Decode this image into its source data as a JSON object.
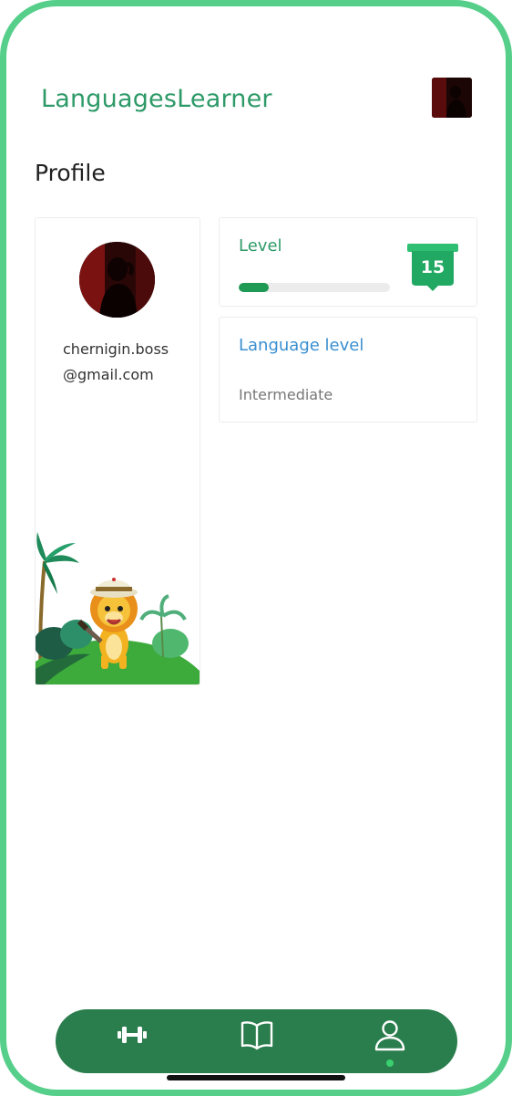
{
  "header": {
    "app_title": "LanguagesLearner"
  },
  "page": {
    "title": "Profile"
  },
  "profile": {
    "email_line1": "chernigin.boss",
    "email_line2": "@gmail.com"
  },
  "level_card": {
    "title": "Level",
    "level": "15",
    "progress_fraction": 0.2
  },
  "language_card": {
    "title": "Language level",
    "value": "Intermediate"
  },
  "tabbar": {
    "tabs": [
      {
        "icon": "dumbbell-icon",
        "active": false
      },
      {
        "icon": "book-icon",
        "active": false
      },
      {
        "icon": "user-icon",
        "active": true
      }
    ]
  },
  "colors": {
    "accent": "#2e9a68",
    "frame": "#56cf8a",
    "tabbar": "#2a7d4c",
    "link_blue": "#3a8fd0",
    "active_dot": "#39d16f"
  }
}
